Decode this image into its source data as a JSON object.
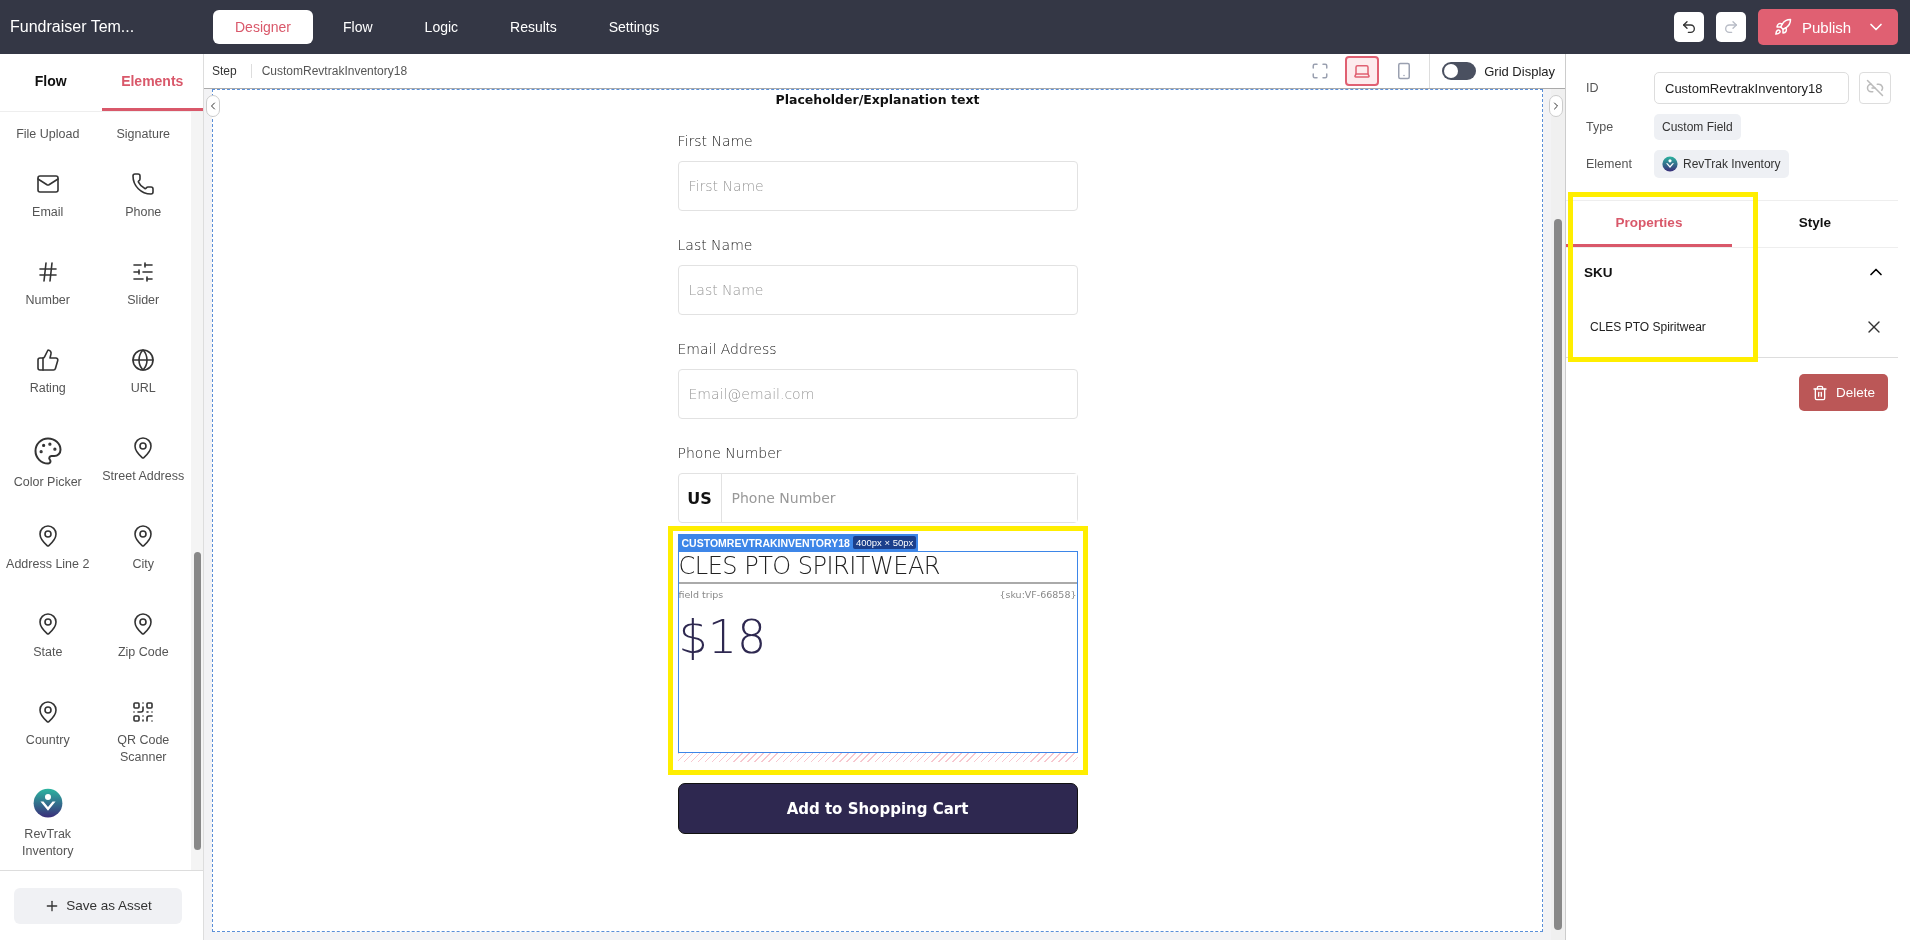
{
  "app": {
    "title": "Fundraiser Tem..."
  },
  "nav_tabs": [
    {
      "label": "Designer",
      "selected": true
    },
    {
      "label": "Flow",
      "selected": false
    },
    {
      "label": "Logic",
      "selected": false
    },
    {
      "label": "Results",
      "selected": false
    },
    {
      "label": "Settings",
      "selected": false
    }
  ],
  "toolbar": {
    "undo": {
      "disabled": false
    },
    "redo": {
      "disabled": true
    },
    "publish": "Publish"
  },
  "sidebar": {
    "tabs": [
      {
        "label": "Flow",
        "selected": false
      },
      {
        "label": "Elements",
        "selected": true
      }
    ],
    "elements": [
      {
        "label": "File Upload",
        "kind": "cut"
      },
      {
        "label": "Signature",
        "kind": "cut"
      },
      {
        "label": "Email",
        "kind": "email"
      },
      {
        "label": "Phone",
        "kind": "phone"
      },
      {
        "label": "Number",
        "kind": "number"
      },
      {
        "label": "Slider",
        "kind": "slider"
      },
      {
        "label": "Rating",
        "kind": "rating"
      },
      {
        "label": "URL",
        "kind": "url"
      },
      {
        "label": "Color Picker",
        "kind": "palette"
      },
      {
        "label": "Street Address",
        "kind": "location"
      },
      {
        "label": "Address Line 2",
        "kind": "location"
      },
      {
        "label": "City",
        "kind": "location"
      },
      {
        "label": "State",
        "kind": "location"
      },
      {
        "label": "Zip Code",
        "kind": "location"
      },
      {
        "label": "Country",
        "kind": "location"
      },
      {
        "label": "QR Code Scanner",
        "kind": "qr"
      },
      {
        "label": "RevTrak Inventory",
        "kind": "logo"
      }
    ],
    "save_button": "Save as Asset"
  },
  "canvas": {
    "breadcrumb": [
      "Step",
      "CustomRevtrakInventory18"
    ],
    "devices": [
      {
        "kind": "fullscreen",
        "selected": false
      },
      {
        "kind": "laptop",
        "selected": true
      },
      {
        "kind": "phone",
        "selected": false
      }
    ],
    "grid_toggle": {
      "label": "Grid Display",
      "on": false
    },
    "form": {
      "explanation": "Placeholder/Explanation text",
      "fields": [
        {
          "label": "First Name",
          "placeholder": "First Name"
        },
        {
          "label": "Last Name",
          "placeholder": "Last Name"
        },
        {
          "label": "Email Address",
          "placeholder": "Email@email.com"
        },
        {
          "label": "Phone Number",
          "placeholder": "Phone Number",
          "prefix": "US"
        }
      ],
      "component": {
        "tag": "CUSTOMREVTRAKINVENTORY18",
        "size": "400px × 50px",
        "title": "CLES PTO SPIRITWEAR",
        "category": "field trips",
        "sku": "{sku:VF-66858}",
        "price": "$18"
      },
      "submit": "Add to Shopping Cart"
    }
  },
  "inspector": {
    "id_label": "ID",
    "id_value": "CustomRevtrakInventory18",
    "type_label": "Type",
    "type_value": "Custom Field",
    "element_label": "Element",
    "element_value": "RevTrak Inventory",
    "tabs": [
      {
        "label": "Properties",
        "selected": true
      },
      {
        "label": "Style",
        "selected": false
      }
    ],
    "section": {
      "title": "SKU",
      "expanded": true,
      "items": [
        "CLES PTO Spiritwear"
      ]
    },
    "delete": "Delete"
  }
}
